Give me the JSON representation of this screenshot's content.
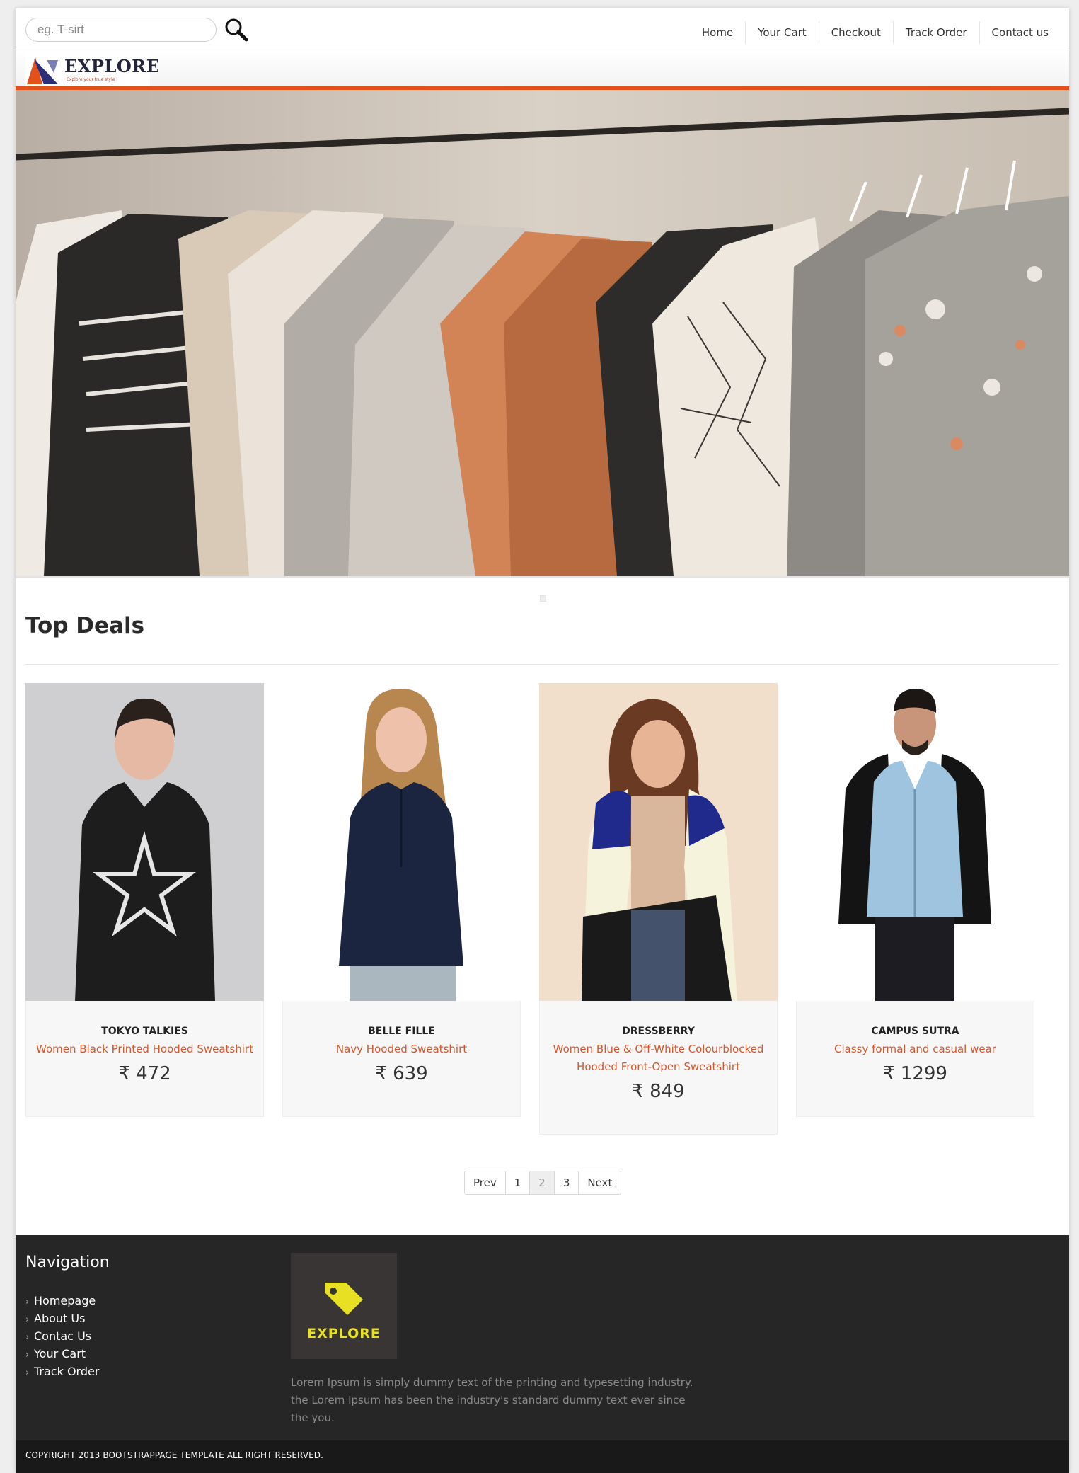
{
  "search": {
    "placeholder": "eg. T-sirt"
  },
  "nav": [
    "Home",
    "Your Cart",
    "Checkout",
    "Track Order",
    "Contact us"
  ],
  "logo": {
    "name": "EXPLORE",
    "tagline": "Explore your true style"
  },
  "deals": {
    "title": "Top Deals",
    "products": [
      {
        "brand": "TOKYO TALKIES",
        "name": "Women Black Printed Hooded Sweatshirt",
        "price": "₹ 472"
      },
      {
        "brand": "BELLE FILLE",
        "name": "Navy Hooded Sweatshirt",
        "price": "₹ 639"
      },
      {
        "brand": "DRESSBERRY",
        "name": "Women Blue & Off-White Colourblocked Hooded Front-Open Sweatshirt",
        "price": "₹ 849"
      },
      {
        "brand": "CAMPUS SUTRA",
        "name": "Classy formal and casual wear",
        "price": "₹ 1299"
      }
    ]
  },
  "pagination": {
    "prev": "Prev",
    "pages": [
      "1",
      "2",
      "3"
    ],
    "current": "2",
    "next": "Next"
  },
  "footer": {
    "nav_title": "Navigation",
    "links": [
      "Homepage",
      "About Us",
      "Contac Us",
      "Your Cart",
      "Track Order"
    ],
    "logo_text": "EXPLORE",
    "about": "Lorem Ipsum is simply dummy text of the printing and typesetting industry. the Lorem Ipsum has been the industry's standard dummy text ever since the you.",
    "copyright": "COPYRIGHT 2013 BOOTSTRAPPAGE TEMPLATE ALL RIGHT RESERVED."
  },
  "colors": {
    "accent": "#e2511c",
    "product_link": "#d7562c",
    "footer_bg": "#262626",
    "footer_logo_yellow": "#e8e023"
  }
}
